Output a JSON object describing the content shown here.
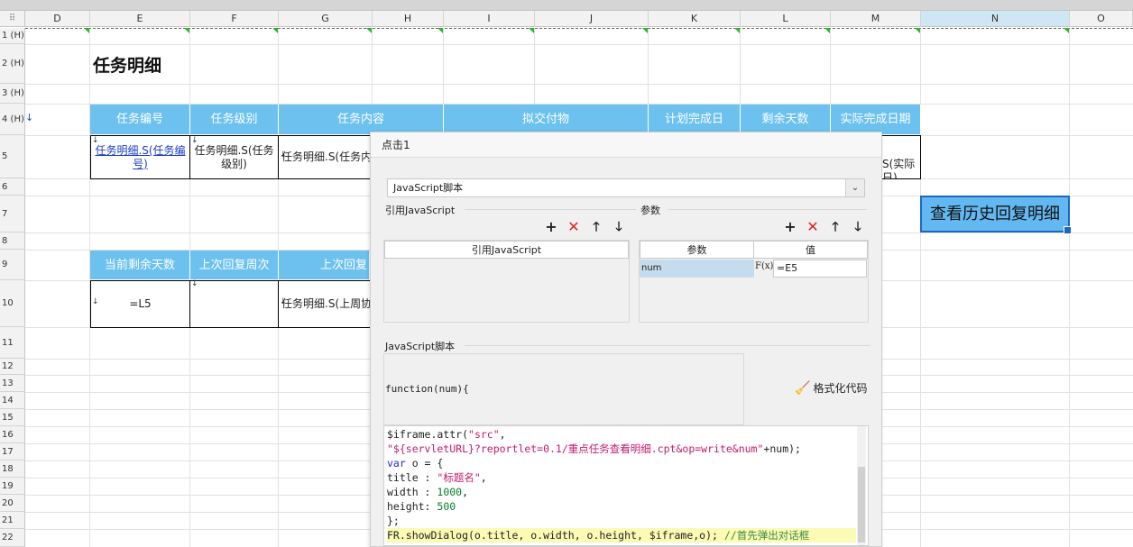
{
  "columns": [
    "D",
    "E",
    "F",
    "G",
    "H",
    "I",
    "J",
    "K",
    "L",
    "M",
    "N",
    "O"
  ],
  "corner": "⠿",
  "rows": [
    "1 (H)",
    "2 (H)",
    "3 (H)",
    "4 (H)",
    "5",
    "6",
    "7",
    "8",
    "9",
    "10",
    "11",
    "12",
    "13",
    "14",
    "15",
    "16",
    "17",
    "18",
    "19",
    "20",
    "21",
    "22"
  ],
  "sheet": {
    "title": "任务明细",
    "header1": [
      "任务编号",
      "任务级别",
      "任务内容",
      "拟交付物",
      "计划完成日",
      "剩余天数",
      "实际完成日期"
    ],
    "row5": {
      "e": "任务明细.S(任务编号)",
      "f": "任务明细.S(任务级别)",
      "g": "任务明细.S(任务内",
      "m": "S(实际\n日)"
    },
    "header2": [
      "当前剩余天数",
      "上次回复周次",
      "上次回复"
    ],
    "row10": {
      "e": "=L5",
      "g": "任务明细.S(上周协"
    },
    "history_button": "查看历史回复明细"
  },
  "dialog": {
    "title": "点击1",
    "script_type": "JavaScript脚本",
    "ref_section": "引用JavaScript",
    "ref_column": "引用JavaScript",
    "param_section": "参数",
    "param_columns": [
      "参数",
      "值"
    ],
    "param_row": {
      "name": "num",
      "fx": "F(x)",
      "value": "=E5"
    },
    "script_section": "JavaScript脚本",
    "function_sig": "function(num){",
    "format_code": "格式化代码",
    "toolbar_icons": [
      "+",
      "✕",
      "🡑",
      "🡓"
    ]
  }
}
